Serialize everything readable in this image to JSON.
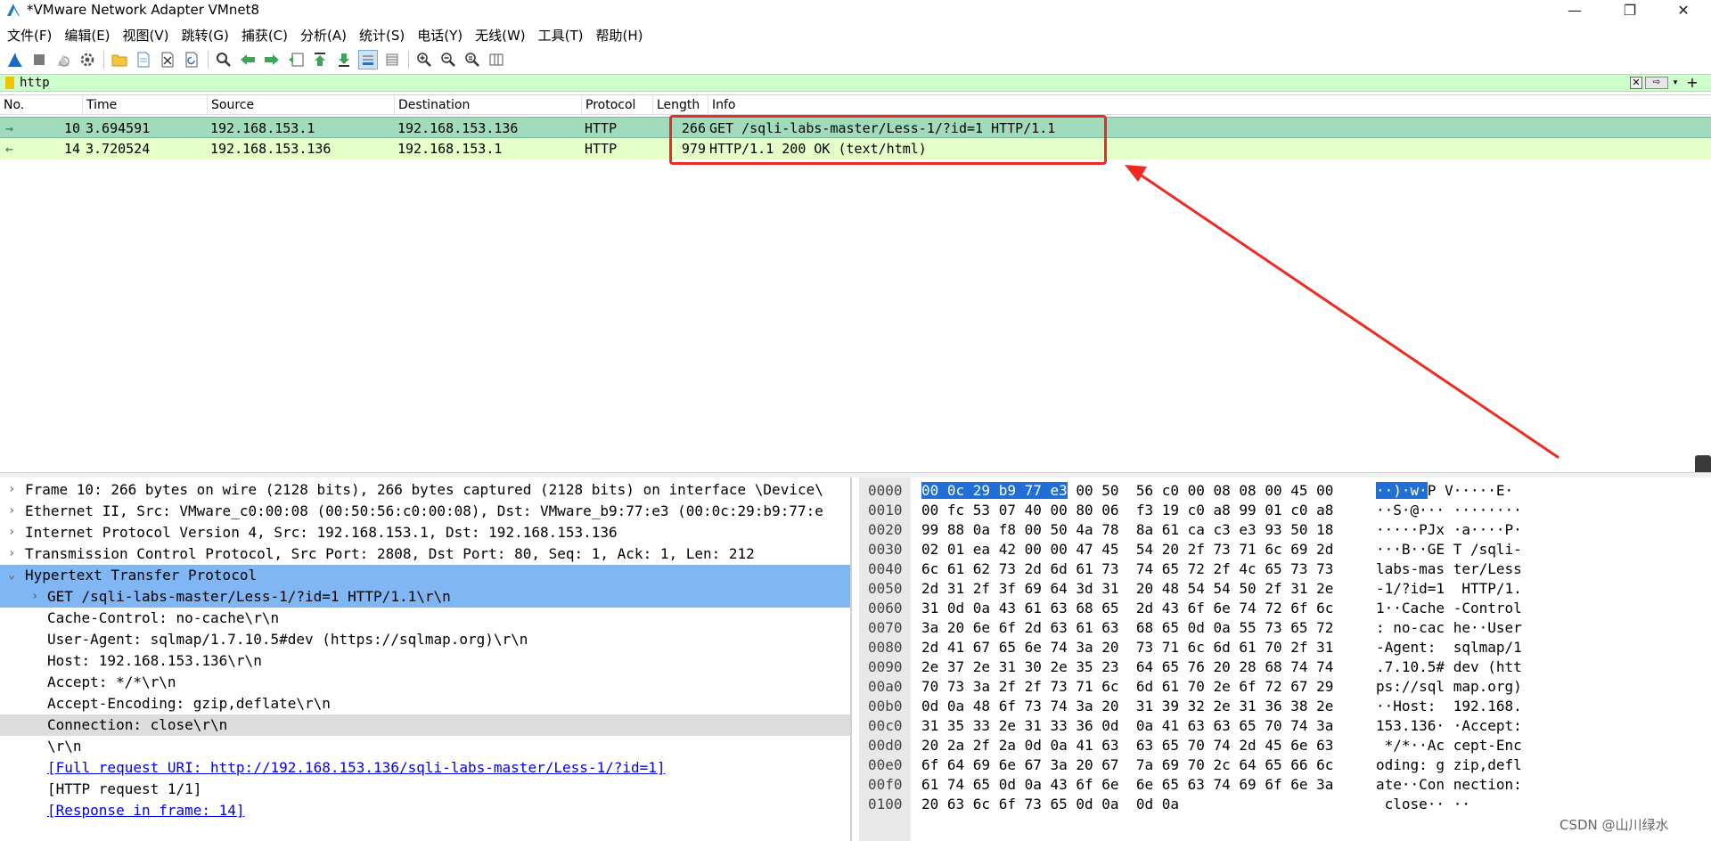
{
  "window": {
    "title": "*VMware Network Adapter VMnet8",
    "icon": "wireshark-fin-icon",
    "controls": {
      "minimize": "—",
      "maximize": "❐",
      "close": "✕"
    }
  },
  "menu": [
    "文件(F)",
    "编辑(E)",
    "视图(V)",
    "跳转(G)",
    "捕获(C)",
    "分析(A)",
    "统计(S)",
    "电话(Y)",
    "无线(W)",
    "工具(T)",
    "帮助(H)"
  ],
  "filter": {
    "value": "http"
  },
  "packet_list": {
    "columns": [
      "No.",
      "Time",
      "Source",
      "Destination",
      "Protocol",
      "Length",
      "Info"
    ],
    "rows": [
      {
        "no": "10",
        "time": "3.694591",
        "source": "192.168.153.1",
        "destination": "192.168.153.136",
        "protocol": "HTTP",
        "length": "266",
        "info": "GET /sqli-labs-master/Less-1/?id=1 HTTP/1.1",
        "direction": "→",
        "color": "#a0dcbc"
      },
      {
        "no": "14",
        "time": "3.720524",
        "source": "192.168.153.136",
        "destination": "192.168.153.1",
        "protocol": "HTTP",
        "length": "979",
        "info": "HTTP/1.1 200 OK  (text/html)",
        "direction": "←",
        "color": "#e4ffc7"
      }
    ],
    "annotation_color": "#ee2a24"
  },
  "details": [
    {
      "arrow": "›",
      "text": "Frame 10: 266 bytes on wire (2128 bits), 266 bytes captured (2128 bits) on interface \\Device\\"
    },
    {
      "arrow": "›",
      "text": "Ethernet II, Src: VMware_c0:00:08 (00:50:56:c0:00:08), Dst: VMware_b9:77:e3 (00:0c:29:b9:77:e"
    },
    {
      "arrow": "›",
      "text": "Internet Protocol Version 4, Src: 192.168.153.1, Dst: 192.168.153.136"
    },
    {
      "arrow": "›",
      "text": "Transmission Control Protocol, Src Port: 2808, Dst Port: 80, Seq: 1, Ack: 1, Len: 212"
    },
    {
      "arrow": "⌄",
      "text": "Hypertext Transfer Protocol"
    },
    {
      "arrow": "›",
      "text": "GET /sqli-labs-master/Less-1/?id=1 HTTP/1.1\\r\\n"
    },
    {
      "arrow": "",
      "text": "Cache-Control: no-cache\\r\\n"
    },
    {
      "arrow": "",
      "text": "User-Agent: sqlmap/1.7.10.5#dev (https://sqlmap.org)\\r\\n"
    },
    {
      "arrow": "",
      "text": "Host: 192.168.153.136\\r\\n"
    },
    {
      "arrow": "",
      "text": "Accept: */*\\r\\n"
    },
    {
      "arrow": "",
      "text": "Accept-Encoding: gzip,deflate\\r\\n"
    },
    {
      "arrow": "",
      "text": "Connection: close\\r\\n"
    },
    {
      "arrow": "",
      "text": "\\r\\n"
    },
    {
      "arrow": "",
      "text": "[Full request URI: http://192.168.153.136/sqli-labs-master/Less-1/?id=1]"
    },
    {
      "arrow": "",
      "text": "[HTTP request 1/1]"
    },
    {
      "arrow": "",
      "text": "[Response in frame: 14]"
    }
  ],
  "bytes": [
    {
      "offset": "0000",
      "hex_hl": "00 0c 29 b9 77 e3",
      "hex": " 00 50  56 c0 00 08 08 00 45 00",
      "ascii_hl": "··)·w·",
      "ascii": "P V·····E·"
    },
    {
      "offset": "0010",
      "hex_hl": "",
      "hex": "00 fc 53 07 40 00 80 06  f3 19 c0 a8 99 01 c0 a8",
      "ascii_hl": "",
      "ascii": "··S·@··· ········"
    },
    {
      "offset": "0020",
      "hex_hl": "",
      "hex": "99 88 0a f8 00 50 4a 78  8a 61 ca c3 e3 93 50 18",
      "ascii_hl": "",
      "ascii": "·····PJx ·a····P·"
    },
    {
      "offset": "0030",
      "hex_hl": "",
      "hex": "02 01 ea 42 00 00 47 45  54 20 2f 73 71 6c 69 2d",
      "ascii_hl": "",
      "ascii": "···B··GE T /sqli-"
    },
    {
      "offset": "0040",
      "hex_hl": "",
      "hex": "6c 61 62 73 2d 6d 61 73  74 65 72 2f 4c 65 73 73",
      "ascii_hl": "",
      "ascii": "labs-mas ter/Less"
    },
    {
      "offset": "0050",
      "hex_hl": "",
      "hex": "2d 31 2f 3f 69 64 3d 31  20 48 54 54 50 2f 31 2e",
      "ascii_hl": "",
      "ascii": "-1/?id=1  HTTP/1."
    },
    {
      "offset": "0060",
      "hex_hl": "",
      "hex": "31 0d 0a 43 61 63 68 65  2d 43 6f 6e 74 72 6f 6c",
      "ascii_hl": "",
      "ascii": "1··Cache -Control"
    },
    {
      "offset": "0070",
      "hex_hl": "",
      "hex": "3a 20 6e 6f 2d 63 61 63  68 65 0d 0a 55 73 65 72",
      "ascii_hl": "",
      "ascii": ": no-cac he··User"
    },
    {
      "offset": "0080",
      "hex_hl": "",
      "hex": "2d 41 67 65 6e 74 3a 20  73 71 6c 6d 61 70 2f 31",
      "ascii_hl": "",
      "ascii": "-Agent:  sqlmap/1"
    },
    {
      "offset": "0090",
      "hex_hl": "",
      "hex": "2e 37 2e 31 30 2e 35 23  64 65 76 20 28 68 74 74",
      "ascii_hl": "",
      "ascii": ".7.10.5# dev (htt"
    },
    {
      "offset": "00a0",
      "hex_hl": "",
      "hex": "70 73 3a 2f 2f 73 71 6c  6d 61 70 2e 6f 72 67 29",
      "ascii_hl": "",
      "ascii": "ps://sql map.org)"
    },
    {
      "offset": "00b0",
      "hex_hl": "",
      "hex": "0d 0a 48 6f 73 74 3a 20  31 39 32 2e 31 36 38 2e",
      "ascii_hl": "",
      "ascii": "··Host:  192.168."
    },
    {
      "offset": "00c0",
      "hex_hl": "",
      "hex": "31 35 33 2e 31 33 36 0d  0a 41 63 63 65 70 74 3a",
      "ascii_hl": "",
      "ascii": "153.136· ·Accept:"
    },
    {
      "offset": "00d0",
      "hex_hl": "",
      "hex": "20 2a 2f 2a 0d 0a 41 63  63 65 70 74 2d 45 6e 63",
      "ascii_hl": "",
      "ascii": " */*··Ac cept-Enc"
    },
    {
      "offset": "00e0",
      "hex_hl": "",
      "hex": "6f 64 69 6e 67 3a 20 67  7a 69 70 2c 64 65 66 6c",
      "ascii_hl": "",
      "ascii": "oding: g zip,defl"
    },
    {
      "offset": "00f0",
      "hex_hl": "",
      "hex": "61 74 65 0d 0a 43 6f 6e  6e 65 63 74 69 6f 6e 3a",
      "ascii_hl": "",
      "ascii": "ate··Con nection:"
    },
    {
      "offset": "0100",
      "hex_hl": "",
      "hex": "20 63 6c 6f 73 65 0d 0a  0d 0a",
      "ascii_hl": "",
      "ascii": " close·· ··"
    }
  ],
  "watermark": "CSDN @山川绿水"
}
